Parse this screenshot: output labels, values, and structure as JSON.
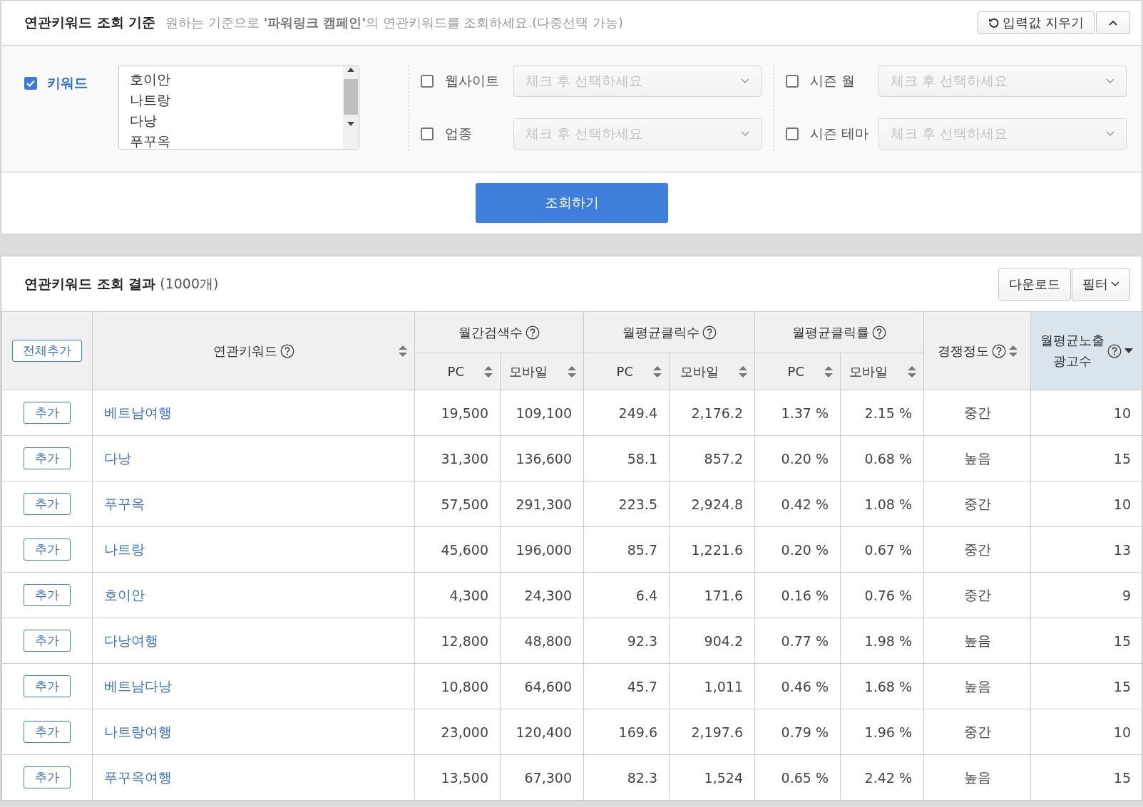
{
  "criteria": {
    "title": "연관키워드 조회 기준",
    "description": "원하는 기준으로 **'파워링크 캠페인'**의 연관키워드를 조회하세요.(다중선택 가능)",
    "reset_button": "입력값 지우기",
    "keyword_filter": {
      "label": "키워드",
      "checked": true,
      "items": [
        "호이안",
        "나트랑",
        "다낭",
        "푸꾸옥"
      ]
    },
    "filters": [
      {
        "label": "웹사이트",
        "checked": false,
        "placeholder": "체크 후 선택하세요"
      },
      {
        "label": "시즌 월",
        "checked": false,
        "placeholder": "체크 후 선택하세요"
      },
      {
        "label": "업종",
        "checked": false,
        "placeholder": "체크 후 선택하세요"
      },
      {
        "label": "시즌 테마",
        "checked": false,
        "placeholder": "체크 후 선택하세요"
      }
    ],
    "search_button": "조회하기"
  },
  "results": {
    "title": "연관키워드 조회 결과",
    "count": "(1000개)",
    "download_button": "다운로드",
    "filter_button": "필터",
    "table": {
      "columns": [
        {
          "kind": "button",
          "label": "전체추가"
        },
        {
          "kind": "link",
          "label": "연관키워드",
          "help": true,
          "sorted_desc": false
        },
        {
          "kind": "group",
          "label": "월간검색수",
          "help": true,
          "colspan": 2,
          "columns": [
            {
              "label": "PC",
              "sorted_desc": false
            },
            {
              "label": "모바일",
              "sorted_desc": false
            }
          ]
        },
        {
          "kind": "group",
          "label": "월평균클릭수",
          "help": true,
          "colspan": 2,
          "columns": [
            {
              "label": "PC",
              "sorted_desc": false
            },
            {
              "label": "모바일",
              "sorted_desc": false
            }
          ]
        },
        {
          "kind": "group",
          "label": "월평균클릭률",
          "help": true,
          "colspan": 2,
          "columns": [
            {
              "label": "PC",
              "sorted_desc": false
            },
            {
              "label": "모바일",
              "sorted_desc": false
            }
          ]
        },
        {
          "kind": "single",
          "label": "경쟁정도",
          "help": true,
          "sorted_desc": false
        },
        {
          "kind": "single",
          "label": "월평균노출 광고수",
          "help": true,
          "sorted_desc": true
        }
      ],
      "rows": [
        {
          "cells": [
            "추가",
            "베트남여행",
            "19,500",
            "109,100",
            "249.4",
            "2,176.2",
            "1.37 %",
            "2.15 %",
            "중간",
            "10"
          ]
        },
        {
          "cells": [
            "추가",
            "다낭",
            "31,300",
            "136,600",
            "58.1",
            "857.2",
            "0.20 %",
            "0.68 %",
            "높음",
            "15"
          ]
        },
        {
          "cells": [
            "추가",
            "푸꾸옥",
            "57,500",
            "291,300",
            "223.5",
            "2,924.8",
            "0.42 %",
            "1.08 %",
            "중간",
            "10"
          ]
        },
        {
          "cells": [
            "추가",
            "나트랑",
            "45,600",
            "196,000",
            "85.7",
            "1,221.6",
            "0.20 %",
            "0.67 %",
            "중간",
            "13"
          ]
        },
        {
          "cells": [
            "추가",
            "호이안",
            "4,300",
            "24,300",
            "6.4",
            "171.6",
            "0.16 %",
            "0.76 %",
            "중간",
            "9"
          ]
        },
        {
          "cells": [
            "추가",
            "다낭여행",
            "12,800",
            "48,800",
            "92.3",
            "904.2",
            "0.77 %",
            "1.98 %",
            "높음",
            "15"
          ]
        },
        {
          "cells": [
            "추가",
            "베트남다낭",
            "10,800",
            "64,600",
            "45.7",
            "1,011",
            "0.46 %",
            "1.68 %",
            "높음",
            "15"
          ]
        },
        {
          "cells": [
            "추가",
            "나트랑여행",
            "23,000",
            "120,400",
            "169.6",
            "2,197.6",
            "0.79 %",
            "1.96 %",
            "중간",
            "10"
          ]
        },
        {
          "cells": [
            "추가",
            "푸꾸옥여행",
            "13,500",
            "67,300",
            "82.3",
            "1,524",
            "0.65 %",
            "2.42 %",
            "높음",
            "15"
          ]
        }
      ]
    }
  }
}
